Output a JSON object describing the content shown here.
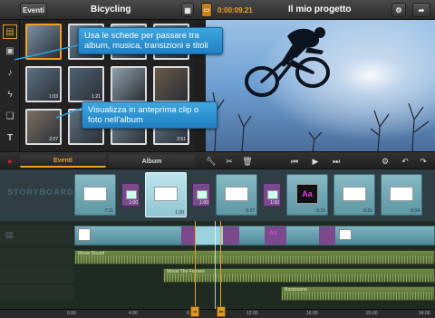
{
  "topbar": {
    "back_label": "Eventi",
    "event_title": "Bicycling",
    "timecode": "0:00:09.21",
    "project_title": "Il mio progetto"
  },
  "callouts": {
    "tabs_help": "Usa le schede per passare tra album, musica, transizioni e titoli",
    "preview_help": "Visualizza in anteprima clip o foto nell'album"
  },
  "library": {
    "thumbs": [
      {
        "count": "",
        "tone": "#7b8fa5"
      },
      {
        "count": "",
        "tone": "#6a7f92"
      },
      {
        "count": "",
        "tone": "#8a9aa8"
      },
      {
        "count": "",
        "tone": "#556878"
      },
      {
        "count": "1:03",
        "tone": "#5e7282"
      },
      {
        "count": "1:21",
        "tone": "#4f6272"
      },
      {
        "count": "",
        "tone": "#90a0ac"
      },
      {
        "count": "",
        "tone": "#6a5a4a"
      },
      {
        "count": "2:27",
        "tone": "#7d6f64"
      },
      {
        "count": "",
        "tone": "#5f7080"
      },
      {
        "count": "",
        "tone": "#7a8a96"
      },
      {
        "count": "2:51",
        "tone": "#66768a"
      }
    ]
  },
  "tabs": {
    "events": "Eventi",
    "album": "Album"
  },
  "storyboard": {
    "label": "STORYBOARD",
    "clips": [
      {
        "kind": "clip",
        "duration": "7:11"
      },
      {
        "kind": "trans",
        "duration": "1:00"
      },
      {
        "kind": "clip",
        "duration": "1:20"
      },
      {
        "kind": "trans",
        "duration": "1:00"
      },
      {
        "kind": "clip",
        "duration": "0:27"
      },
      {
        "kind": "trans",
        "duration": "1:00"
      },
      {
        "kind": "title",
        "duration": "5:15"
      },
      {
        "kind": "clip",
        "duration": "6:21"
      },
      {
        "kind": "clip",
        "duration": "5:04"
      }
    ]
  },
  "timeline": {
    "audio_tracks": [
      {
        "label": "Movie Sound"
      },
      {
        "label": "Movie The Frames"
      },
      {
        "label": "Backsound"
      }
    ]
  },
  "ruler": {
    "ticks": [
      "0.00",
      "4.00",
      "8.00",
      "12.00",
      "16.00",
      "20.00",
      "24.00"
    ]
  },
  "colors": {
    "accent_orange": "#f0a020",
    "callout_blue": "#2a8fd6",
    "title_aa": "#e040e0"
  }
}
